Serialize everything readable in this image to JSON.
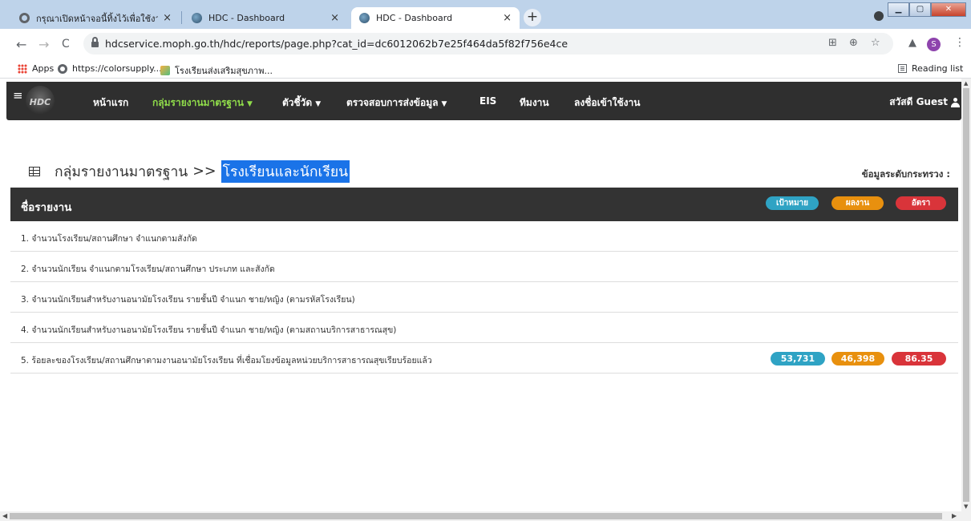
{
  "browser": {
    "tabs": [
      {
        "title": "กรุณาเปิดหน้าจอนี้ทิ้งไว้เพื่อใช้งาน Inte",
        "active": false
      },
      {
        "title": "HDC - Dashboard",
        "active": false
      },
      {
        "title": "HDC - Dashboard",
        "active": true
      }
    ],
    "tab_close": "×",
    "new_tab": "+",
    "window_buttons": {
      "minimize": "▁",
      "maximize": "▢",
      "close": "✕"
    },
    "url": "hdcservice.moph.go.th/hdc/reports/page.php?cat_id=dc6012062b7e25f464da5f82f756e4ce",
    "nav": {
      "back": "←",
      "forward": "→",
      "reload": "C"
    },
    "avatar_letter": "S",
    "menu": "⋮",
    "bookmarks": [
      {
        "label": "Apps",
        "icon": "apps-icon"
      },
      {
        "label": "https://colorsupply...",
        "icon": "globe-icon"
      },
      {
        "label": "โรงเรียนส่งเสริมสุขภาพ...",
        "icon": "leaf-icon"
      }
    ],
    "reading_list": "Reading list"
  },
  "site": {
    "logo_text": "HDC",
    "menu_icon": "≡",
    "nav": [
      {
        "label": "หน้าแรก",
        "dropdown": false,
        "active": false
      },
      {
        "label": "กลุ่มรายงานมาตรฐาน",
        "dropdown": true,
        "active": true
      },
      {
        "label": "ตัวชี้วัด",
        "dropdown": true,
        "active": false
      },
      {
        "label": "ตรวจสอบการส่งข้อมูล",
        "dropdown": true,
        "active": false
      },
      {
        "label": "EIS",
        "dropdown": false,
        "active": false
      },
      {
        "label": "ทีมงาน",
        "dropdown": false,
        "active": false
      },
      {
        "label": "ลงชื่อเข้าใช้งาน",
        "dropdown": false,
        "active": false
      }
    ],
    "caret": "▼",
    "greeting": "สวัสดี Guest"
  },
  "page": {
    "breadcrumb_root": "กลุ่มรายงานมาตรฐาน",
    "breadcrumb_sep": ">>",
    "breadcrumb_current": "โรงเรียนและนักเรียน",
    "level_label": "ข้อมูลระดับกระทรวง :"
  },
  "report_table": {
    "header": "ชื่อรายงาน",
    "badges": {
      "target": "เป้าหมาย",
      "result": "ผลงาน",
      "rate": "อัตรา"
    },
    "rows": [
      {
        "title": "1. จำนวนโรงเรียน/สถานศึกษา จำแนกตามสังกัด"
      },
      {
        "title": "2. จำนวนนักเรียน จำแนกตามโรงเรียน/สถานศึกษา ประเภท และสังกัด"
      },
      {
        "title": "3. จำนวนนักเรียนสำหรับงานอนามัยโรงเรียน รายชั้นปี จำแนก ชาย/หญิง (ตามรหัสโรงเรียน)"
      },
      {
        "title": "4. จำนวนนักเรียนสำหรับงานอนามัยโรงเรียน รายชั้นปี จำแนก ชาย/หญิง (ตามสถานบริการสาธารณสุข)"
      },
      {
        "title": "5. ร้อยละของโรงเรียน/สถานศึกษาตามงานอนามัยโรงเรียน ที่เชื่อมโยงข้อมูลหน่วยบริการสาธารณสุขเรียบร้อยแล้ว",
        "target": "53,731",
        "result": "46,398",
        "rate": "86.35"
      }
    ]
  },
  "colors": {
    "navbar": "#2f2f2f",
    "nav_active": "#8fdb4a",
    "target": "#2fa3c4",
    "result": "#e8900e",
    "rate": "#d9343a",
    "highlight": "#1a73e8"
  }
}
